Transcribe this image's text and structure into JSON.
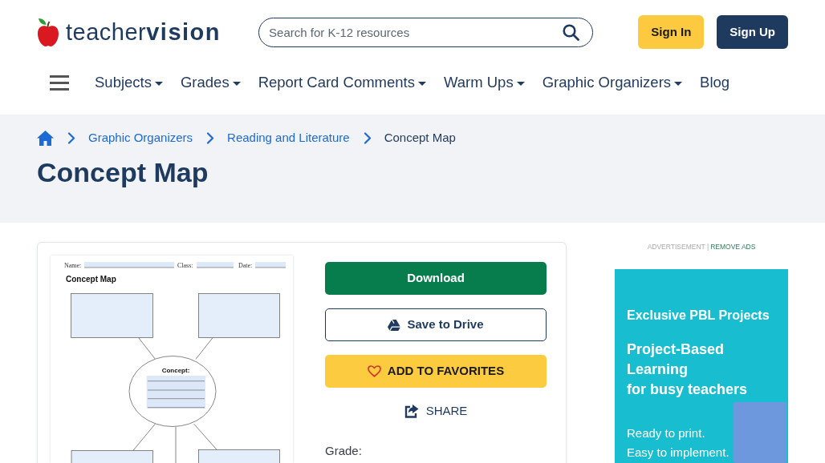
{
  "header": {
    "logo": "teacher**vision**",
    "search": {
      "placeholder": "Search for K-12 resources"
    },
    "buttons": [
      {
        "label": "Sign In",
        "kind": "sign_in"
      },
      {
        "label": "Sign Up",
        "kind": "sign_up"
      }
    ]
  },
  "nav": {
    "items": [
      {
        "label": "Subjects",
        "dropdown": true
      },
      {
        "label": "Grades",
        "dropdown": true
      },
      {
        "label": "Report Card Comments",
        "dropdown": true
      },
      {
        "label": "Warm Ups",
        "dropdown": true
      },
      {
        "label": "Graphic Organizers",
        "dropdown": true
      },
      {
        "label": "Blog",
        "dropdown": false
      }
    ]
  },
  "breadcrumb": [
    {
      "label": "Graphic Organizers",
      "current": false
    },
    {
      "label": "Reading and Literature",
      "current": false
    },
    {
      "label": "Concept Map",
      "current": true
    }
  ],
  "page_title": "Concept Map",
  "worksheet": {
    "header_fields": [
      "Name:",
      "Class:",
      "Date:"
    ],
    "title": "Concept Map",
    "center_label": "Concept:"
  },
  "actions": [
    {
      "kind": "download",
      "label": "Download"
    },
    {
      "kind": "drive",
      "label": "Save to Drive"
    },
    {
      "kind": "favorite",
      "label": "ADD TO FAVORITES"
    },
    {
      "kind": "share",
      "label": "SHARE"
    }
  ],
  "details": {
    "grade_label": "Grade:"
  },
  "ad": {
    "label": "ADVERTISEMENT |",
    "remove_link": "REMOVE ADS",
    "kicker": "Exclusive PBL Projects",
    "headline": [
      "Project-Based",
      "Learning",
      "for busy teachers"
    ],
    "lines": [
      "Ready to print.",
      "Easy to implement."
    ]
  }
}
